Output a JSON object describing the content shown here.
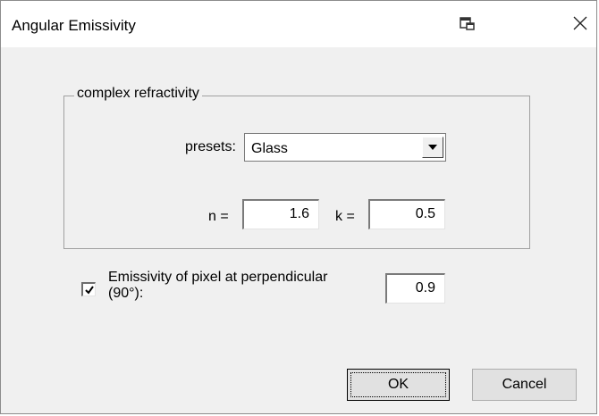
{
  "window": {
    "title": "Angular Emissivity",
    "titlebar_icon": "window-restore-icon",
    "close_icon": "close-icon"
  },
  "refractivity_group": {
    "label": "complex refractivity",
    "presets_label": "presets:",
    "presets_selected": "Glass",
    "n_label": "n =",
    "n_value": "1.6",
    "k_label": "k =",
    "k_value": "0.5"
  },
  "emissivity": {
    "checked": true,
    "label_line1": "Emissivity of pixel at perpendicular",
    "label_line2": "(90°):",
    "value": "0.9"
  },
  "buttons": {
    "ok_label": "OK",
    "cancel_label": "Cancel"
  },
  "colors": {
    "dialog_bg": "#f0f0f0",
    "titlebar_bg": "#ffffff",
    "button_bg": "#e1e1e1"
  }
}
